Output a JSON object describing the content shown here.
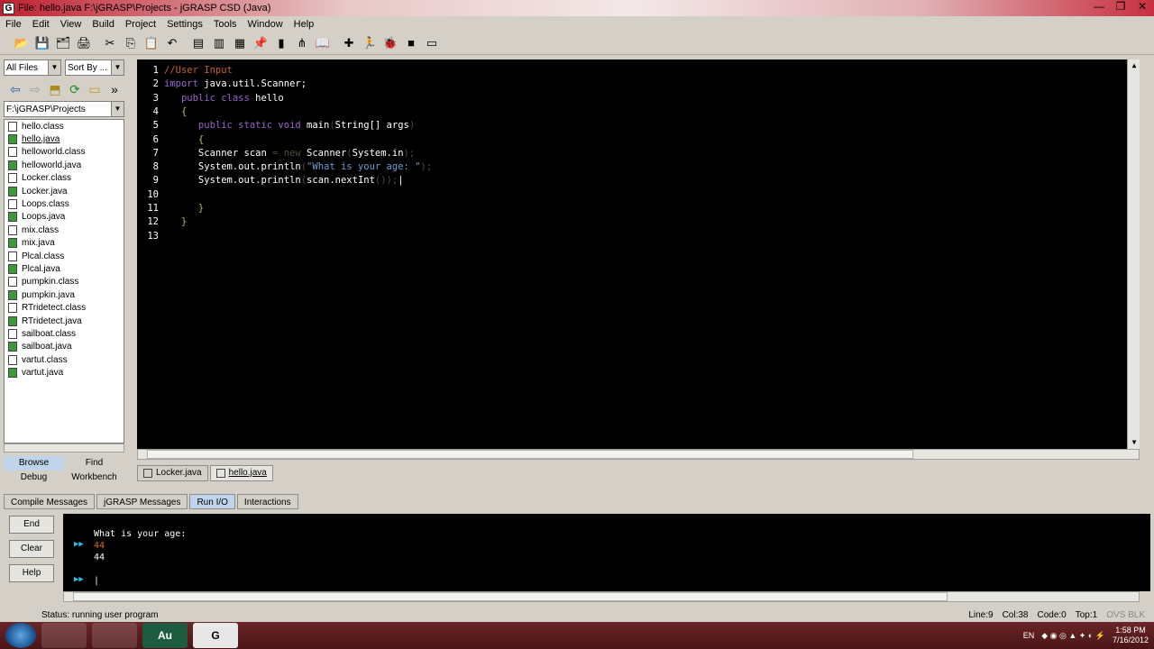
{
  "window": {
    "title": "File: hello.java  F:\\jGRASP\\Projects - jGRASP CSD (Java)",
    "app_icon": "G",
    "min_label": "—",
    "max_label": "❐",
    "close_label": "✕"
  },
  "menu": [
    "File",
    "Edit",
    "View",
    "Build",
    "Project",
    "Settings",
    "Tools",
    "Window",
    "Help"
  ],
  "toolbar_icons": [
    "open-folder-icon",
    "save-icon",
    "save-all-icon",
    "print-icon",
    "cut-icon",
    "copy-icon",
    "paste-icon",
    "undo-icon",
    "page-icon",
    "page2-icon",
    "page3-icon",
    "pin-icon",
    "bar-chart-icon",
    "tree-icon",
    "book-icon",
    "compile-plus-icon",
    "run-icon",
    "debug-bug-icon",
    "stop-icon",
    "window-icon"
  ],
  "toolbar_glyphs": [
    "📂",
    "💾",
    "🗂",
    "🖨",
    "✂",
    "⎘",
    "📋",
    "↶",
    "▤",
    "▥",
    "▦",
    "📌",
    "▮",
    "⋔",
    "📖",
    "✚",
    "🏃",
    "🐞",
    "■",
    "▭"
  ],
  "left": {
    "filter_label": "All Files",
    "sort_label": "Sort By ...",
    "path": "F:\\jGRASP\\Projects",
    "more_label": "»",
    "files": [
      {
        "name": "hello.class",
        "type": "class"
      },
      {
        "name": "hello.java",
        "type": "java",
        "selected": true
      },
      {
        "name": "helloworld.class",
        "type": "class"
      },
      {
        "name": "helloworld.java",
        "type": "java"
      },
      {
        "name": "Locker.class",
        "type": "class"
      },
      {
        "name": "Locker.java",
        "type": "java"
      },
      {
        "name": "Loops.class",
        "type": "class"
      },
      {
        "name": "Loops.java",
        "type": "java"
      },
      {
        "name": "mix.class",
        "type": "class"
      },
      {
        "name": "mix.java",
        "type": "java"
      },
      {
        "name": "Plcal.class",
        "type": "class"
      },
      {
        "name": "Plcal.java",
        "type": "java"
      },
      {
        "name": "pumpkin.class",
        "type": "class"
      },
      {
        "name": "pumpkin.java",
        "type": "java"
      },
      {
        "name": "RTridetect.class",
        "type": "class"
      },
      {
        "name": "RTridetect.java",
        "type": "java"
      },
      {
        "name": "sailboat.class",
        "type": "class"
      },
      {
        "name": "sailboat.java",
        "type": "java"
      },
      {
        "name": "vartut.class",
        "type": "class"
      },
      {
        "name": "vartut.java",
        "type": "java"
      }
    ],
    "tabs": [
      "Browse",
      "Find",
      "Debug",
      "Workbench"
    ]
  },
  "editor": {
    "lines": [
      {
        "n": "1",
        "parts": [
          {
            "t": "//User Input",
            "c": "c-comment"
          }
        ]
      },
      {
        "n": "2",
        "parts": [
          {
            "t": "import",
            "c": "c-kw"
          },
          {
            "t": " java.util.Scanner;",
            "c": "c-plain"
          }
        ]
      },
      {
        "n": "3",
        "parts": [
          {
            "t": "   public class",
            "c": "c-kw"
          },
          {
            "t": " hello",
            "c": "c-plain"
          }
        ]
      },
      {
        "n": "4",
        "parts": [
          {
            "t": "   {",
            "c": "c-brace"
          }
        ]
      },
      {
        "n": "5",
        "parts": [
          {
            "t": "      public static void",
            "c": "c-kw"
          },
          {
            "t": " main",
            "c": "c-plain"
          },
          {
            "t": "(",
            "c": "c-dim"
          },
          {
            "t": "String[] args",
            "c": "c-plain"
          },
          {
            "t": ")",
            "c": "c-dim"
          }
        ]
      },
      {
        "n": "6",
        "parts": [
          {
            "t": "      {",
            "c": "c-brace"
          }
        ]
      },
      {
        "n": "7",
        "parts": [
          {
            "t": "      Scanner scan ",
            "c": "c-plain"
          },
          {
            "t": "= new",
            "c": "c-dim"
          },
          {
            "t": " Scanner",
            "c": "c-plain"
          },
          {
            "t": "(",
            "c": "c-dim"
          },
          {
            "t": "System.in",
            "c": "c-plain"
          },
          {
            "t": ");",
            "c": "c-dim"
          }
        ]
      },
      {
        "n": "8",
        "parts": [
          {
            "t": "      System.out.println",
            "c": "c-plain"
          },
          {
            "t": "(",
            "c": "c-dim"
          },
          {
            "t": "\"What is your age: \"",
            "c": "c-str"
          },
          {
            "t": ");",
            "c": "c-dim"
          }
        ]
      },
      {
        "n": "9",
        "parts": [
          {
            "t": "      System.out.println",
            "c": "c-plain"
          },
          {
            "t": "(",
            "c": "c-dim"
          },
          {
            "t": "scan.nextInt",
            "c": "c-plain"
          },
          {
            "t": "());",
            "c": "c-dim"
          },
          {
            "t": "|",
            "c": "c-plain"
          }
        ]
      },
      {
        "n": "10",
        "parts": []
      },
      {
        "n": "11",
        "parts": [
          {
            "t": "      }",
            "c": "c-brace"
          }
        ]
      },
      {
        "n": "12",
        "parts": [
          {
            "t": "   }",
            "c": "c-brace"
          }
        ]
      },
      {
        "n": "13",
        "parts": []
      }
    ],
    "tabs": [
      {
        "label": "Locker.java",
        "active": false
      },
      {
        "label": "hello.java",
        "active": true
      }
    ]
  },
  "bottom": {
    "tabs": [
      {
        "label": "Compile Messages",
        "active": false
      },
      {
        "label": "jGRASP Messages",
        "active": false
      },
      {
        "label": "Run I/O",
        "active": true
      },
      {
        "label": "Interactions",
        "active": false
      }
    ],
    "buttons": [
      "End",
      "Clear",
      "Help"
    ],
    "output": [
      {
        "text": "What is your age:",
        "color": "#ffffff",
        "arrow": false
      },
      {
        "text": "44",
        "color": "#e07020",
        "arrow": true
      },
      {
        "text": "44",
        "color": "#ffffff",
        "arrow": false
      },
      {
        "text": "|",
        "color": "#ffffff",
        "arrow": true,
        "gap": true
      }
    ]
  },
  "status": {
    "message": "Status: running user program",
    "line": "Line:9",
    "col": "Col:38",
    "code": "Code:0",
    "top": "Top:1",
    "ovs": "OVS BLK"
  },
  "taskbar": {
    "apps": [
      "steam-icon",
      "window-icon",
      "audition-icon",
      "jgrasp-icon"
    ],
    "app_labels": [
      "",
      "",
      "Au",
      "G"
    ],
    "lang": "EN",
    "time": "1:58 PM",
    "date": "7/16/2012"
  }
}
